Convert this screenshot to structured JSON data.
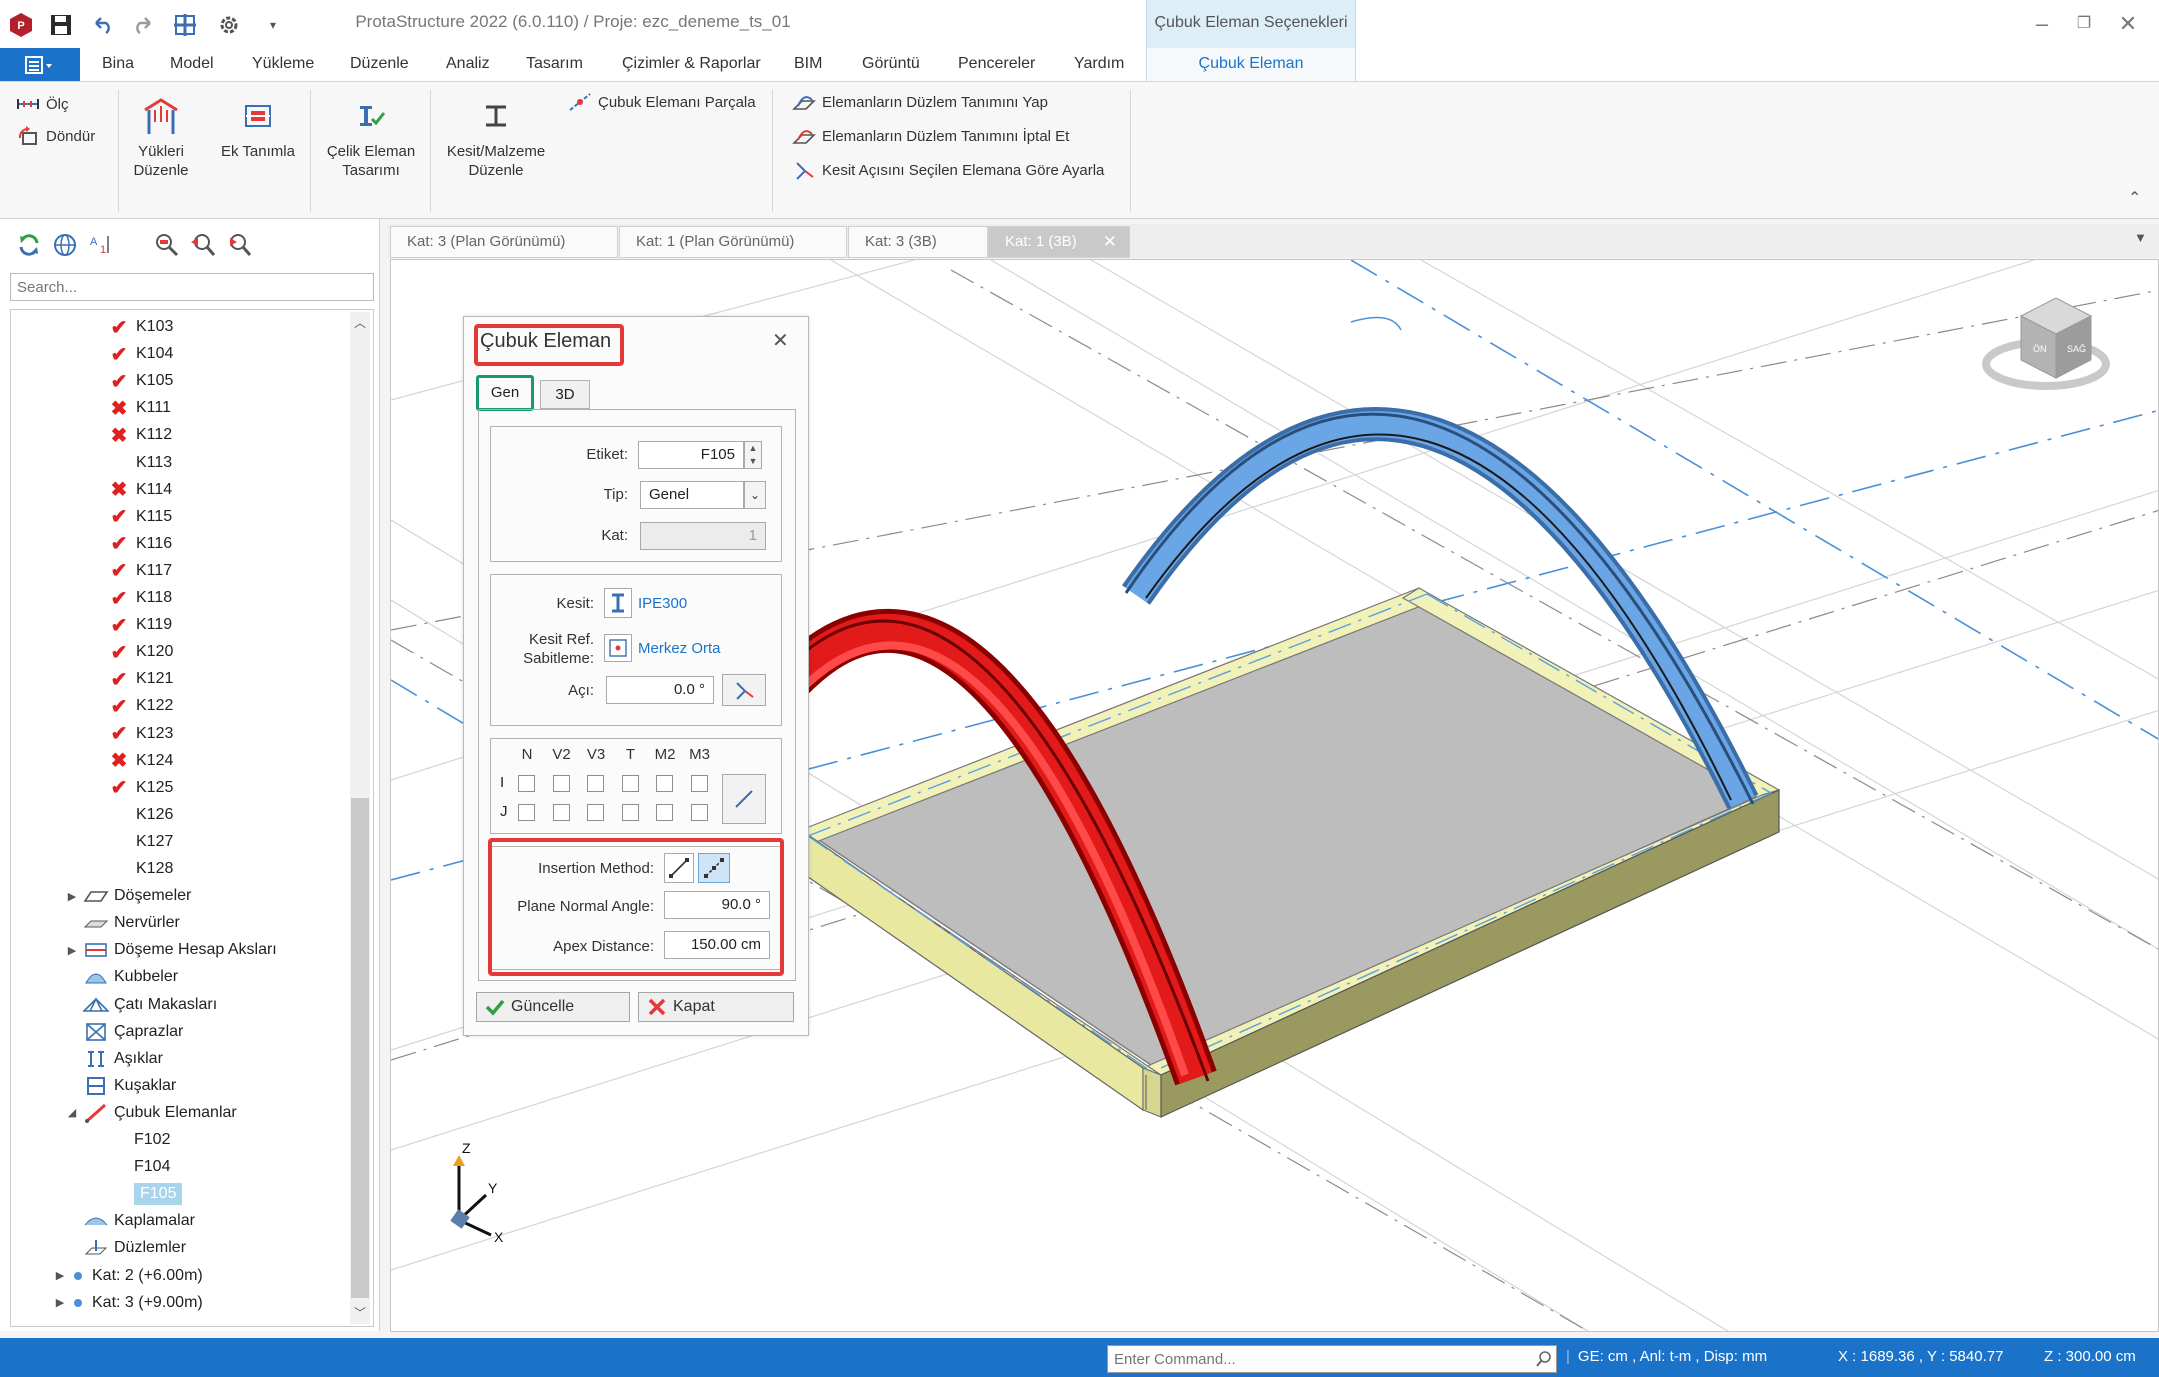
{
  "app": {
    "title": "ProtaStructure 2022 (6.0.110) / Proje: ezc_deneme_ts_01",
    "context_header": "Çubuk Eleman Seçenekleri",
    "context_tab": "Çubuk Eleman"
  },
  "menu": [
    "Bina",
    "Model",
    "Yükleme",
    "Düzenle",
    "Analiz",
    "Tasarım",
    "Çizimler & Raporlar",
    "BIM",
    "Görüntü",
    "Pencereler",
    "Yardım"
  ],
  "ribbon": {
    "olc": "Ölç",
    "dondur": "Döndür",
    "yukleri_duzenle": [
      "Yükleri",
      "Düzenle"
    ],
    "ek_tanimla": "Ek Tanımla",
    "celik_eleman": [
      "Çelik Eleman",
      "Tasarımı"
    ],
    "kesit_malzeme": [
      "Kesit/Malzeme",
      "Düzenle"
    ],
    "cubuk_parcala": "Çubuk Elemanı Parçala",
    "duzlem_yap": "Elemanların Düzlem Tanımını Yap",
    "duzlem_iptal": "Elemanların Düzlem Tanımını İptal Et",
    "kesit_acisi": "Kesit Açısını Seçilen Elemana Göre Ayarla"
  },
  "left_panel": {
    "search_placeholder": "Search...",
    "tree": [
      {
        "label": "K103",
        "mark": "ok"
      },
      {
        "label": "K104",
        "mark": "ok"
      },
      {
        "label": "K105",
        "mark": "ok"
      },
      {
        "label": "K111",
        "mark": "x"
      },
      {
        "label": "K112",
        "mark": "x"
      },
      {
        "label": "K113",
        "mark": "none"
      },
      {
        "label": "K114",
        "mark": "x"
      },
      {
        "label": "K115",
        "mark": "ok"
      },
      {
        "label": "K116",
        "mark": "ok"
      },
      {
        "label": "K117",
        "mark": "ok"
      },
      {
        "label": "K118",
        "mark": "ok"
      },
      {
        "label": "K119",
        "mark": "ok"
      },
      {
        "label": "K120",
        "mark": "ok"
      },
      {
        "label": "K121",
        "mark": "ok"
      },
      {
        "label": "K122",
        "mark": "ok"
      },
      {
        "label": "K123",
        "mark": "ok"
      },
      {
        "label": "K124",
        "mark": "x"
      },
      {
        "label": "K125",
        "mark": "ok"
      },
      {
        "label": "K126",
        "mark": "none"
      },
      {
        "label": "K127",
        "mark": "none"
      },
      {
        "label": "K128",
        "mark": "none"
      }
    ],
    "folders": [
      {
        "label": "Döşemeler",
        "icon": "slab-icon"
      },
      {
        "label": "Nervürler",
        "icon": "rib-icon"
      },
      {
        "label": "Döşeme Hesap Aksları",
        "icon": "slab-axis-icon"
      },
      {
        "label": "Kubbeler",
        "icon": "dome-icon"
      },
      {
        "label": "Çatı Makasları",
        "icon": "truss-icon"
      },
      {
        "label": "Çaprazlar",
        "icon": "brace-icon"
      },
      {
        "label": "Aşıklar",
        "icon": "purlin-icon"
      },
      {
        "label": "Kuşaklar",
        "icon": "girt-icon"
      },
      {
        "label": "Çubuk Elemanlar",
        "icon": "member-icon"
      }
    ],
    "members": [
      "F102",
      "F104",
      "F105"
    ],
    "tail": [
      {
        "label": "Kaplamalar",
        "icon": "cladding-icon"
      },
      {
        "label": "Düzlemler",
        "icon": "plane-icon"
      }
    ],
    "storeys": [
      "Kat: 2 (+6.00m)",
      "Kat: 3 (+9.00m)"
    ]
  },
  "tabs": [
    "Kat: 3 (Plan Görünümü)",
    "Kat: 1 (Plan Görünümü)",
    "Kat: 3 (3B)",
    "Kat: 1 (3B)"
  ],
  "dialog": {
    "title": "Çubuk Eleman",
    "tab_gen": "Gen",
    "tab_3d": "3D",
    "etiket_label": "Etiket:",
    "etiket_value": "F105",
    "tip_label": "Tip:",
    "tip_value": "Genel",
    "kat_label": "Kat:",
    "kat_value": "1",
    "kesit_label": "Kesit:",
    "kesit_value": "IPE300",
    "kesit_ref_label": [
      "Kesit Ref.",
      "Sabitleme:"
    ],
    "kesit_ref_value": "Merkez Orta",
    "aci_label": "Açı:",
    "aci_value": "0.0 °",
    "release_cols": [
      "N",
      "V2",
      "V3",
      "T",
      "M2",
      "M3"
    ],
    "release_rows": [
      "I",
      "J"
    ],
    "insertion_label": "Insertion Method:",
    "plane_angle_label": "Plane Normal Angle:",
    "plane_angle_value": "90.0 °",
    "apex_label": "Apex Distance:",
    "apex_value": "150.00 cm",
    "update_btn": "Güncelle",
    "close_btn": "Kapat"
  },
  "viewcube": {
    "front": "ÖN",
    "side": "SAĞ"
  },
  "axes": {
    "z": "Z",
    "y": "Y",
    "x": "X"
  },
  "status": {
    "command_placeholder": "Enter Command...",
    "units": "GE: cm , Anl: t-m , Disp: mm",
    "coords": "X : 1689.36 , Y : 5840.77",
    "z": "Z : 300.00 cm"
  },
  "colors": {
    "accent": "#1a73c8",
    "red_arch": "#e21a1a",
    "blue_arch": "#5b9be0",
    "beam": "#f0f0b8",
    "slab": "#b8b8b8",
    "highlight_red": "#e53939",
    "highlight_green": "#159a72"
  }
}
